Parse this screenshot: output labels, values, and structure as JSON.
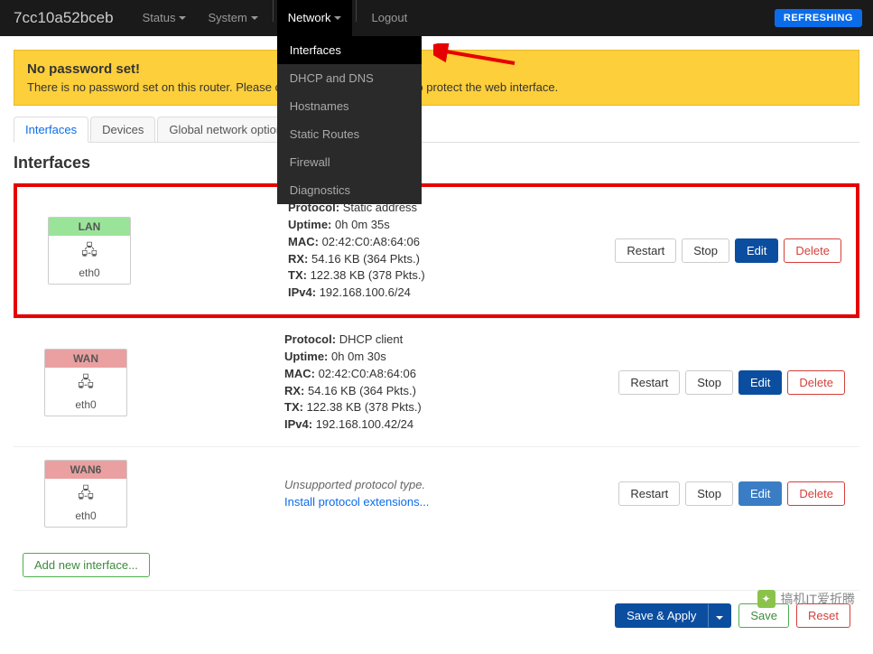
{
  "navbar": {
    "brand": "7cc10a52bceb",
    "items": [
      {
        "label": "Status"
      },
      {
        "label": "System"
      },
      {
        "label": "Network"
      },
      {
        "label": "Logout"
      }
    ],
    "refresh": "REFRESHING",
    "dropdown": [
      {
        "label": "Interfaces"
      },
      {
        "label": "DHCP and DNS"
      },
      {
        "label": "Hostnames"
      },
      {
        "label": "Static Routes"
      },
      {
        "label": "Firewall"
      },
      {
        "label": "Diagnostics"
      }
    ]
  },
  "alert": {
    "title": "No password set!",
    "text": "There is no password set on this router. Please configure a root password to protect the web interface."
  },
  "tabs": [
    {
      "label": "Interfaces"
    },
    {
      "label": "Devices"
    },
    {
      "label": "Global network options"
    }
  ],
  "page_title": "Interfaces",
  "interfaces": [
    {
      "name": "LAN",
      "dev": "eth0",
      "color": "green",
      "info": {
        "protocol_k": "Protocol:",
        "protocol_v": "Static address",
        "uptime_k": "Uptime:",
        "uptime_v": "0h 0m 35s",
        "mac_k": "MAC:",
        "mac_v": "02:42:C0:A8:64:06",
        "rx_k": "RX:",
        "rx_v": "54.16 KB (364 Pkts.)",
        "tx_k": "TX:",
        "tx_v": "122.38 KB (378 Pkts.)",
        "ipv4_k": "IPv4:",
        "ipv4_v": "192.168.100.6/24"
      }
    },
    {
      "name": "WAN",
      "dev": "eth0",
      "color": "red",
      "info": {
        "protocol_k": "Protocol:",
        "protocol_v": "DHCP client",
        "uptime_k": "Uptime:",
        "uptime_v": "0h 0m 30s",
        "mac_k": "MAC:",
        "mac_v": "02:42:C0:A8:64:06",
        "rx_k": "RX:",
        "rx_v": "54.16 KB (364 Pkts.)",
        "tx_k": "TX:",
        "tx_v": "122.38 KB (378 Pkts.)",
        "ipv4_k": "IPv4:",
        "ipv4_v": "192.168.100.42/24"
      }
    },
    {
      "name": "WAN6",
      "dev": "eth0",
      "color": "red",
      "unsupported": "Unsupported protocol type.",
      "install_link": "Install protocol extensions..."
    }
  ],
  "row_actions": {
    "restart": "Restart",
    "stop": "Stop",
    "edit": "Edit",
    "delete": "Delete"
  },
  "add_button": "Add new interface...",
  "footer": {
    "save_apply": "Save & Apply",
    "save": "Save",
    "reset": "Reset"
  },
  "watermark": "搞机IT爱折腾"
}
